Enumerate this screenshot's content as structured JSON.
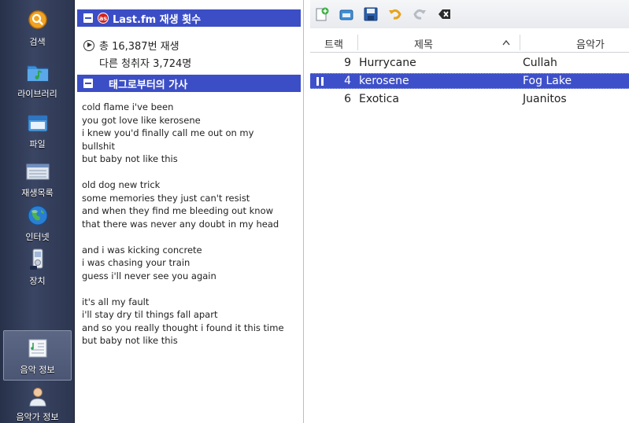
{
  "sidebar": {
    "items": [
      {
        "label": "검색",
        "icon": "search-icon"
      },
      {
        "label": "라이브러리",
        "icon": "library-icon"
      },
      {
        "label": "파일",
        "icon": "file-icon"
      },
      {
        "label": "재생목록",
        "icon": "playlist-icon"
      },
      {
        "label": "인터넷",
        "icon": "internet-icon"
      },
      {
        "label": "장치",
        "icon": "device-icon"
      },
      {
        "label": "음악 정보",
        "icon": "song-info-icon"
      },
      {
        "label": "음악가 정보",
        "icon": "artist-info-icon"
      }
    ]
  },
  "lastfm": {
    "header": "Last.fm 재생 횟수",
    "plays": "총 16,387번 재생",
    "listeners": "다른 청취자 3,724명"
  },
  "lyrics": {
    "header": "태그로부터의 가사",
    "lines": [
      "cold flame i've been",
      "you got love like kerosene",
      "i knew you'd finally call me out on my",
      "bullshit",
      "but baby not like this",
      "",
      "old dog new trick",
      "some memories they just can't resist",
      "and when they find me bleeding out know",
      " that there was never any doubt in my head",
      "",
      "and i was kicking concrete",
      "i was chasing your train",
      "guess i'll never see you again",
      "",
      "it's all my fault",
      "i'll stay dry til things fall apart",
      "and so you really thought i found it this time",
      "but baby not like this"
    ]
  },
  "playlist": {
    "columns": {
      "track": "트랙",
      "title": "제목",
      "artist": "음악가"
    },
    "rows": [
      {
        "track": "9",
        "title": "Hurrycane",
        "artist": "Cullah",
        "playing": false
      },
      {
        "track": "4",
        "title": "kerosene",
        "artist": "Fog Lake",
        "playing": true
      },
      {
        "track": "6",
        "title": "Exotica",
        "artist": "Juanitos",
        "playing": false
      }
    ]
  },
  "colors": {
    "accent": "#3c4ec6",
    "sidebar_bg": "#2c3650"
  }
}
